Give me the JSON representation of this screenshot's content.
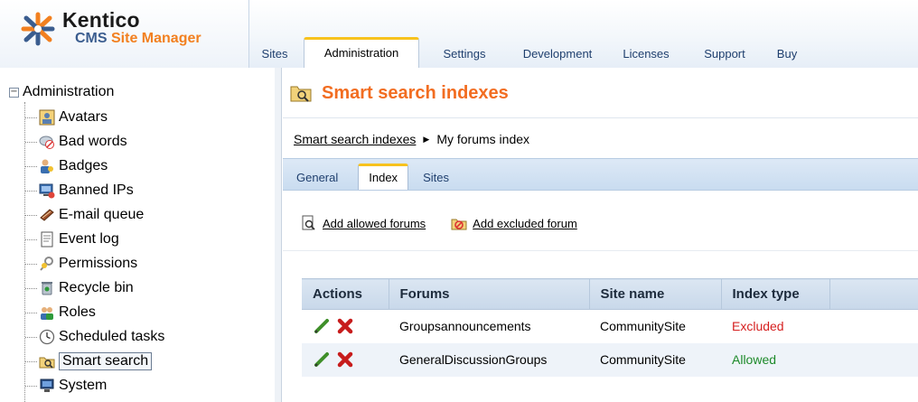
{
  "app": {
    "logo_word": "Kentico",
    "logo_sub_1": "CMS ",
    "logo_sub_2": "Site Manager"
  },
  "top_tabs": [
    {
      "label": "Sites",
      "active": false
    },
    {
      "label": "Administration",
      "active": true
    },
    {
      "label": "Settings",
      "active": false
    },
    {
      "label": "Development",
      "active": false
    },
    {
      "label": "Licenses",
      "active": false
    },
    {
      "label": "Support",
      "active": false
    },
    {
      "label": "Buy",
      "active": false
    }
  ],
  "tree": {
    "root": "Administration",
    "expander": "−",
    "items": [
      {
        "label": "Avatars",
        "icon": "avatar-icon"
      },
      {
        "label": "Bad words",
        "icon": "bad-words-icon"
      },
      {
        "label": "Badges",
        "icon": "badges-icon"
      },
      {
        "label": "Banned IPs",
        "icon": "banned-ips-icon"
      },
      {
        "label": "E-mail queue",
        "icon": "email-queue-icon"
      },
      {
        "label": "Event log",
        "icon": "event-log-icon"
      },
      {
        "label": "Permissions",
        "icon": "permissions-icon"
      },
      {
        "label": "Recycle bin",
        "icon": "recycle-bin-icon"
      },
      {
        "label": "Roles",
        "icon": "roles-icon"
      },
      {
        "label": "Scheduled tasks",
        "icon": "scheduled-tasks-icon"
      },
      {
        "label": "Smart search",
        "icon": "smart-search-icon",
        "selected": true
      },
      {
        "label": "System",
        "icon": "system-icon"
      }
    ]
  },
  "main": {
    "title": "Smart search indexes",
    "breadcrumb": {
      "link": "Smart search indexes",
      "separator": "▶",
      "current": "My forums index"
    },
    "sub_tabs": [
      {
        "label": "General",
        "active": false
      },
      {
        "label": "Index",
        "active": true
      },
      {
        "label": "Sites",
        "active": false
      }
    ],
    "actions": {
      "add_allowed": "Add allowed forums",
      "add_excluded": "Add excluded forum"
    },
    "grid": {
      "headers": [
        "Actions",
        "Forums",
        "Site name",
        "Index type"
      ],
      "rows": [
        {
          "forum": "Groupsannouncements",
          "site": "CommunitySite",
          "type": "Excluded"
        },
        {
          "forum": "GeneralDiscussionGroups",
          "site": "CommunitySite",
          "type": "Allowed"
        }
      ]
    }
  },
  "colors": {
    "title_orange": "#f26d21",
    "tab_accent": "#f7c21e",
    "excluded_red": "#d62121",
    "allowed_green": "#1d8a2a"
  }
}
